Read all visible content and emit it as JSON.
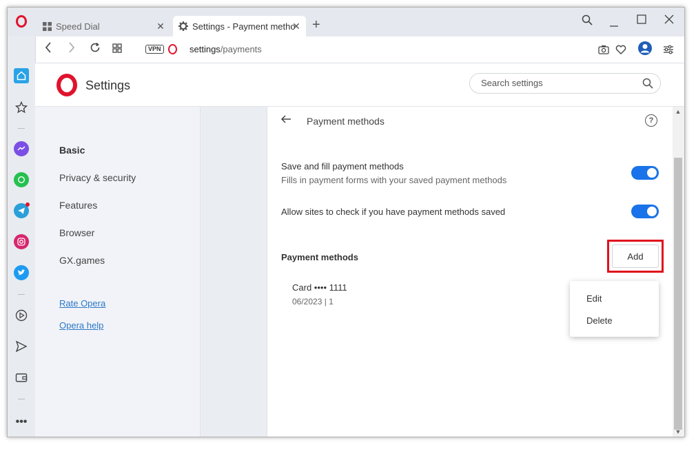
{
  "tabs": [
    {
      "label": "Speed Dial",
      "icon": "grid-icon",
      "active": false
    },
    {
      "label": "Settings - Payment methods",
      "icon": "gear-icon",
      "active": true
    }
  ],
  "window_controls": [
    "search-icon",
    "minimize-icon",
    "maximize-icon",
    "close-icon"
  ],
  "address_bar": {
    "vpn_label": "VPN",
    "url_host": "settings",
    "url_path": "/payments"
  },
  "sidebar": {
    "icons": [
      "home-icon",
      "star-icon",
      "messenger-icon",
      "whatsapp-icon",
      "telegram-icon",
      "instagram-icon",
      "twitter-icon",
      "player-icon",
      "send-icon",
      "wallet-icon",
      "more-icon"
    ]
  },
  "header": {
    "title": "Settings",
    "search_placeholder": "Search settings"
  },
  "nav": {
    "items": [
      "Basic",
      "Privacy & security",
      "Features",
      "Browser",
      "GX.games"
    ],
    "active_index": 0,
    "links": [
      "Rate Opera",
      "Opera help"
    ]
  },
  "content": {
    "title": "Payment methods",
    "save_fill_label": "Save and fill payment methods",
    "save_fill_sub": "Fills in payment forms with your saved payment methods",
    "save_fill_on": true,
    "allow_check_label": "Allow sites to check if you have payment methods saved",
    "allow_check_on": true,
    "section_heading": "Payment methods",
    "add_label": "Add",
    "card_label": "Card •••• 1111",
    "card_expiry": "06/2023 | 1",
    "menu": [
      "Edit",
      "Delete"
    ]
  },
  "colors": {
    "opera_red": "#e0132d",
    "toggle_blue": "#1a73e8",
    "link_blue": "#2a78c6",
    "highlight_red": "#e0101b"
  }
}
